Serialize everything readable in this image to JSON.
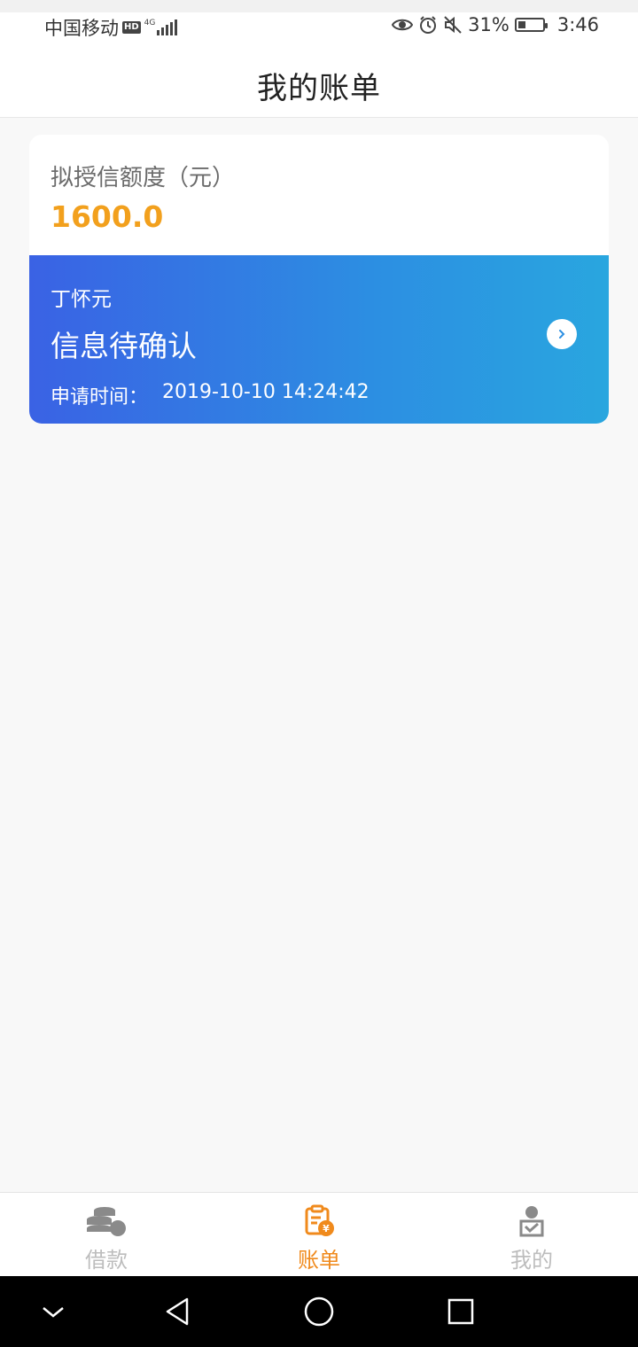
{
  "status_bar": {
    "carrier": "中国移动",
    "hd_label": "HD",
    "network": "4G",
    "battery": "31%",
    "battery_level": 0.31,
    "time": "3:46",
    "icons": [
      "eye-icon",
      "alarm-icon",
      "mute-icon",
      "battery-icon"
    ]
  },
  "header": {
    "title": "我的账单"
  },
  "card": {
    "credit_label": "拟授信额度（元）",
    "credit_value": "1600.0",
    "applicant_name": "丁怀元",
    "status": "信息待确认",
    "apply_time_label": "申请时间：",
    "apply_time_value": "2019-10-10 14:24:42",
    "gradient_colors": [
      "#3a62e4",
      "#29a6df"
    ],
    "accent_color": "#f2a01d"
  },
  "tab_bar": {
    "tabs": [
      {
        "label": "借款",
        "icon": "coins-icon",
        "active": false
      },
      {
        "label": "账单",
        "icon": "bill-icon",
        "active": true
      },
      {
        "label": "我的",
        "icon": "profile-icon",
        "active": false
      }
    ],
    "active_color": "#f08a1c",
    "inactive_color": "#bdbdbd"
  },
  "nav_bar": {
    "buttons": [
      "collapse-icon",
      "back-icon",
      "home-icon",
      "recents-icon"
    ]
  }
}
